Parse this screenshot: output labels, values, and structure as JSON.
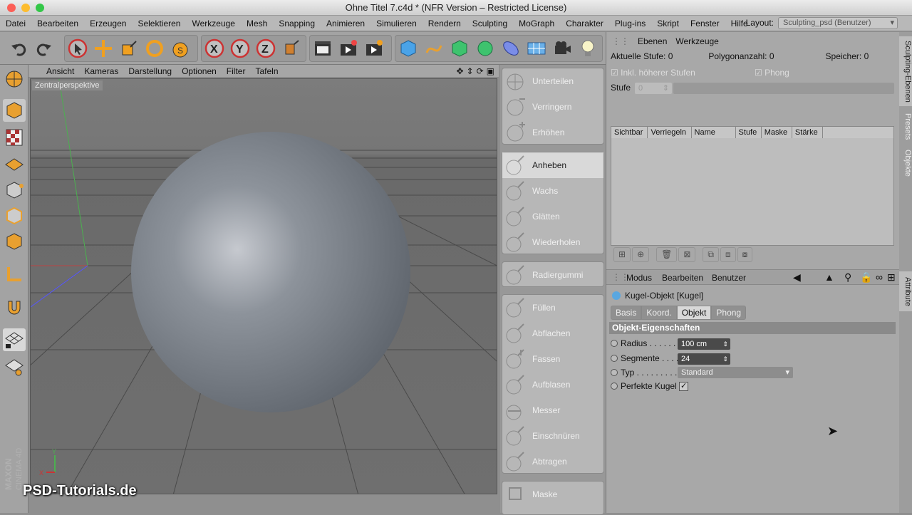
{
  "window": {
    "title": "Ohne Titel 7.c4d * (NFR Version – Restricted License)"
  },
  "menu": [
    "Datei",
    "Bearbeiten",
    "Erzeugen",
    "Selektieren",
    "Werkzeuge",
    "Mesh",
    "Snapping",
    "Animieren",
    "Simulieren",
    "Rendern",
    "Sculpting",
    "MoGraph",
    "Charakter",
    "Plug-ins",
    "Skript",
    "Fenster",
    "Hilfe"
  ],
  "layout": {
    "label": "Layout:",
    "value": "Sculpting_psd (Benutzer)"
  },
  "viewport": {
    "menu": [
      "Ansicht",
      "Kameras",
      "Darstellung",
      "Optionen",
      "Filter",
      "Tafeln"
    ],
    "projection": "Zentralperspektive",
    "axis_y": "Y",
    "axis_x": "X"
  },
  "watermark": "PSD-Tutorials.de",
  "brand": "MAXON CINEMA 4D",
  "brushes": [
    {
      "label": "Unterteilen",
      "group": 0
    },
    {
      "label": "Verringern",
      "group": 0
    },
    {
      "label": "Erhöhen",
      "group": 0
    },
    {
      "label": "Anheben",
      "group": 1,
      "active": true
    },
    {
      "label": "Wachs",
      "group": 1
    },
    {
      "label": "Glätten",
      "group": 1
    },
    {
      "label": "Wiederholen",
      "group": 1
    },
    {
      "label": "Radiergummi",
      "group": 2
    },
    {
      "label": "Füllen",
      "group": 3
    },
    {
      "label": "Abflachen",
      "group": 3
    },
    {
      "label": "Fassen",
      "group": 3
    },
    {
      "label": "Aufblasen",
      "group": 3
    },
    {
      "label": "Messer",
      "group": 3
    },
    {
      "label": "Einschnüren",
      "group": 3
    },
    {
      "label": "Abtragen",
      "group": 3
    },
    {
      "label": "Maske",
      "group": 4
    }
  ],
  "layers": {
    "tabs": [
      "Ebenen",
      "Werkzeuge"
    ],
    "stats": {
      "level_label": "Aktuelle Stufe:",
      "level": "0",
      "poly_label": "Polygonanzahl:",
      "poly": "0",
      "mem_label": "Speicher:",
      "mem": "0"
    },
    "include_higher": "Inkl. höherer Stufen",
    "phong": "Phong",
    "stufe_label": "Stufe",
    "stufe_value": "0",
    "columns": [
      "Sichtbar",
      "Verriegeln",
      "Name",
      "Stufe",
      "Maske",
      "Stärke"
    ]
  },
  "attributes": {
    "menu": [
      "Modus",
      "Bearbeiten",
      "Benutzer"
    ],
    "object": "Kugel-Objekt [Kugel]",
    "tabs": [
      "Basis",
      "Koord.",
      "Objekt",
      "Phong"
    ],
    "active_tab": "Objekt",
    "section": "Objekt-Eigenschaften",
    "props": [
      {
        "label": "Radius . . . . . .",
        "value": "100 cm"
      },
      {
        "label": "Segmente . . . .",
        "value": "24"
      },
      {
        "label": "Typ . . . . . . . . . .",
        "value": "Standard"
      },
      {
        "label": "Perfekte Kugel",
        "value": "✓"
      }
    ]
  },
  "side_tabs": [
    "Sculpting-Ebenen",
    "Presets",
    "Objekte",
    "Attribute"
  ],
  "colors": {
    "sphere": "#8a9099",
    "accent_x": "#cc4444",
    "accent_y": "#4caf50"
  }
}
